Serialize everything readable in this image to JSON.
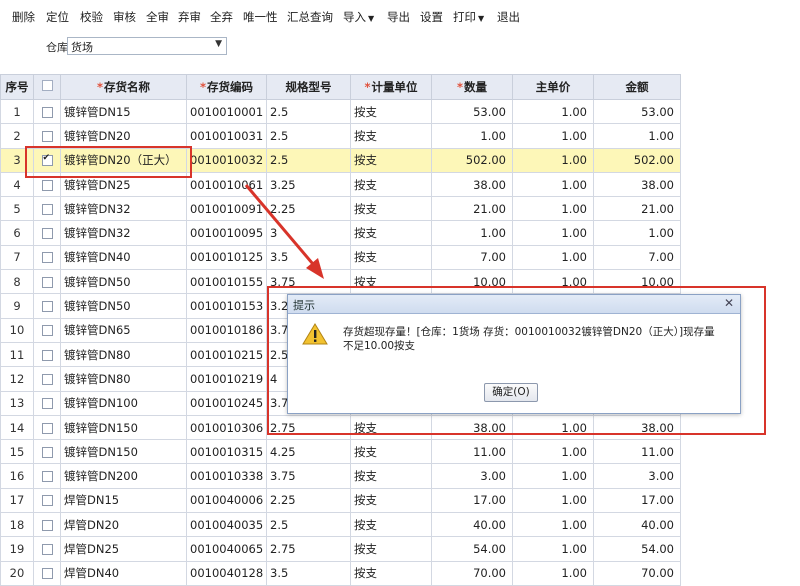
{
  "toolbar": {
    "delete": "删除",
    "locate": "定位",
    "check": "校验",
    "audit": "审核",
    "audit_all": "全审",
    "abandon": "弃审",
    "abandon_all": "全弃",
    "unique": "唯一性",
    "summary_query": "汇总查询",
    "import": "导入",
    "export": "导出",
    "settings": "设置",
    "print": "打印",
    "exit": "退出"
  },
  "filter": {
    "warehouse_label": "仓库",
    "warehouse_value": "货场"
  },
  "table": {
    "headers": {
      "seq": "序号",
      "name": "存货名称",
      "code": "存货编码",
      "spec": "规格型号",
      "unit": "计量单位",
      "qty": "数量",
      "unit_price": "主单价",
      "amount": "金额"
    },
    "rows": [
      {
        "seq": "1",
        "name": "镀锌管DN15",
        "code": "0010010001",
        "spec": "2.5",
        "unit": "按支",
        "qty": "53.00",
        "price": "1.00",
        "amount": "53.00"
      },
      {
        "seq": "2",
        "name": "镀锌管DN20",
        "code": "0010010031",
        "spec": "2.5",
        "unit": "按支",
        "qty": "1.00",
        "price": "1.00",
        "amount": "1.00"
      },
      {
        "seq": "3",
        "name": "镀锌管DN20（正大）",
        "code": "0010010032",
        "spec": "2.5",
        "unit": "按支",
        "qty": "502.00",
        "price": "1.00",
        "amount": "502.00"
      },
      {
        "seq": "4",
        "name": "镀锌管DN25",
        "code": "0010010061",
        "spec": "3.25",
        "unit": "按支",
        "qty": "38.00",
        "price": "1.00",
        "amount": "38.00"
      },
      {
        "seq": "5",
        "name": "镀锌管DN32",
        "code": "0010010091",
        "spec": "2.25",
        "unit": "按支",
        "qty": "21.00",
        "price": "1.00",
        "amount": "21.00"
      },
      {
        "seq": "6",
        "name": "镀锌管DN32",
        "code": "0010010095",
        "spec": "3",
        "unit": "按支",
        "qty": "1.00",
        "price": "1.00",
        "amount": "1.00"
      },
      {
        "seq": "7",
        "name": "镀锌管DN40",
        "code": "0010010125",
        "spec": "3.5",
        "unit": "按支",
        "qty": "7.00",
        "price": "1.00",
        "amount": "7.00"
      },
      {
        "seq": "8",
        "name": "镀锌管DN50",
        "code": "0010010155",
        "spec": "3.75",
        "unit": "按支",
        "qty": "10.00",
        "price": "1.00",
        "amount": "10.00"
      },
      {
        "seq": "9",
        "name": "镀锌管DN50",
        "code": "0010010153",
        "spec": "3.2",
        "unit": "",
        "qty": "",
        "price": "",
        "amount": ""
      },
      {
        "seq": "10",
        "name": "镀锌管DN65",
        "code": "0010010186",
        "spec": "3.7",
        "unit": "",
        "qty": "",
        "price": "",
        "amount": ""
      },
      {
        "seq": "11",
        "name": "镀锌管DN80",
        "code": "0010010215",
        "spec": "2.5",
        "unit": "",
        "qty": "",
        "price": "",
        "amount": ""
      },
      {
        "seq": "12",
        "name": "镀锌管DN80",
        "code": "0010010219",
        "spec": "4",
        "unit": "",
        "qty": "",
        "price": "",
        "amount": ""
      },
      {
        "seq": "13",
        "name": "镀锌管DN100",
        "code": "0010010245",
        "spec": "3.7",
        "unit": "",
        "qty": "",
        "price": "",
        "amount": ""
      },
      {
        "seq": "14",
        "name": "镀锌管DN150",
        "code": "0010010306",
        "spec": "2.75",
        "unit": "按支",
        "qty": "38.00",
        "price": "1.00",
        "amount": "38.00"
      },
      {
        "seq": "15",
        "name": "镀锌管DN150",
        "code": "0010010315",
        "spec": "4.25",
        "unit": "按支",
        "qty": "11.00",
        "price": "1.00",
        "amount": "11.00"
      },
      {
        "seq": "16",
        "name": "镀锌管DN200",
        "code": "0010010338",
        "spec": "3.75",
        "unit": "按支",
        "qty": "3.00",
        "price": "1.00",
        "amount": "3.00"
      },
      {
        "seq": "17",
        "name": "焊管DN15",
        "code": "0010040006",
        "spec": "2.25",
        "unit": "按支",
        "qty": "17.00",
        "price": "1.00",
        "amount": "17.00"
      },
      {
        "seq": "18",
        "name": "焊管DN20",
        "code": "0010040035",
        "spec": "2.5",
        "unit": "按支",
        "qty": "40.00",
        "price": "1.00",
        "amount": "40.00"
      },
      {
        "seq": "19",
        "name": "焊管DN25",
        "code": "0010040065",
        "spec": "2.75",
        "unit": "按支",
        "qty": "54.00",
        "price": "1.00",
        "amount": "54.00"
      },
      {
        "seq": "20",
        "name": "焊管DN40",
        "code": "0010040128",
        "spec": "3.5",
        "unit": "按支",
        "qty": "70.00",
        "price": "1.00",
        "amount": "70.00"
      }
    ],
    "selected_row": 3,
    "colors": {
      "selected_row": "#fdf7b8",
      "header_bg": "#e6eaf3",
      "annotation_red": "#d8342a"
    }
  },
  "dialog": {
    "title": "提示",
    "message": "存货超现存量！[仓库：1货场 存货：0010010032镀锌管DN20（正大）]现存量不足10.00按支",
    "ok_label": "确定(O)",
    "icon": "warning-icon",
    "close_icon": "close-icon"
  }
}
